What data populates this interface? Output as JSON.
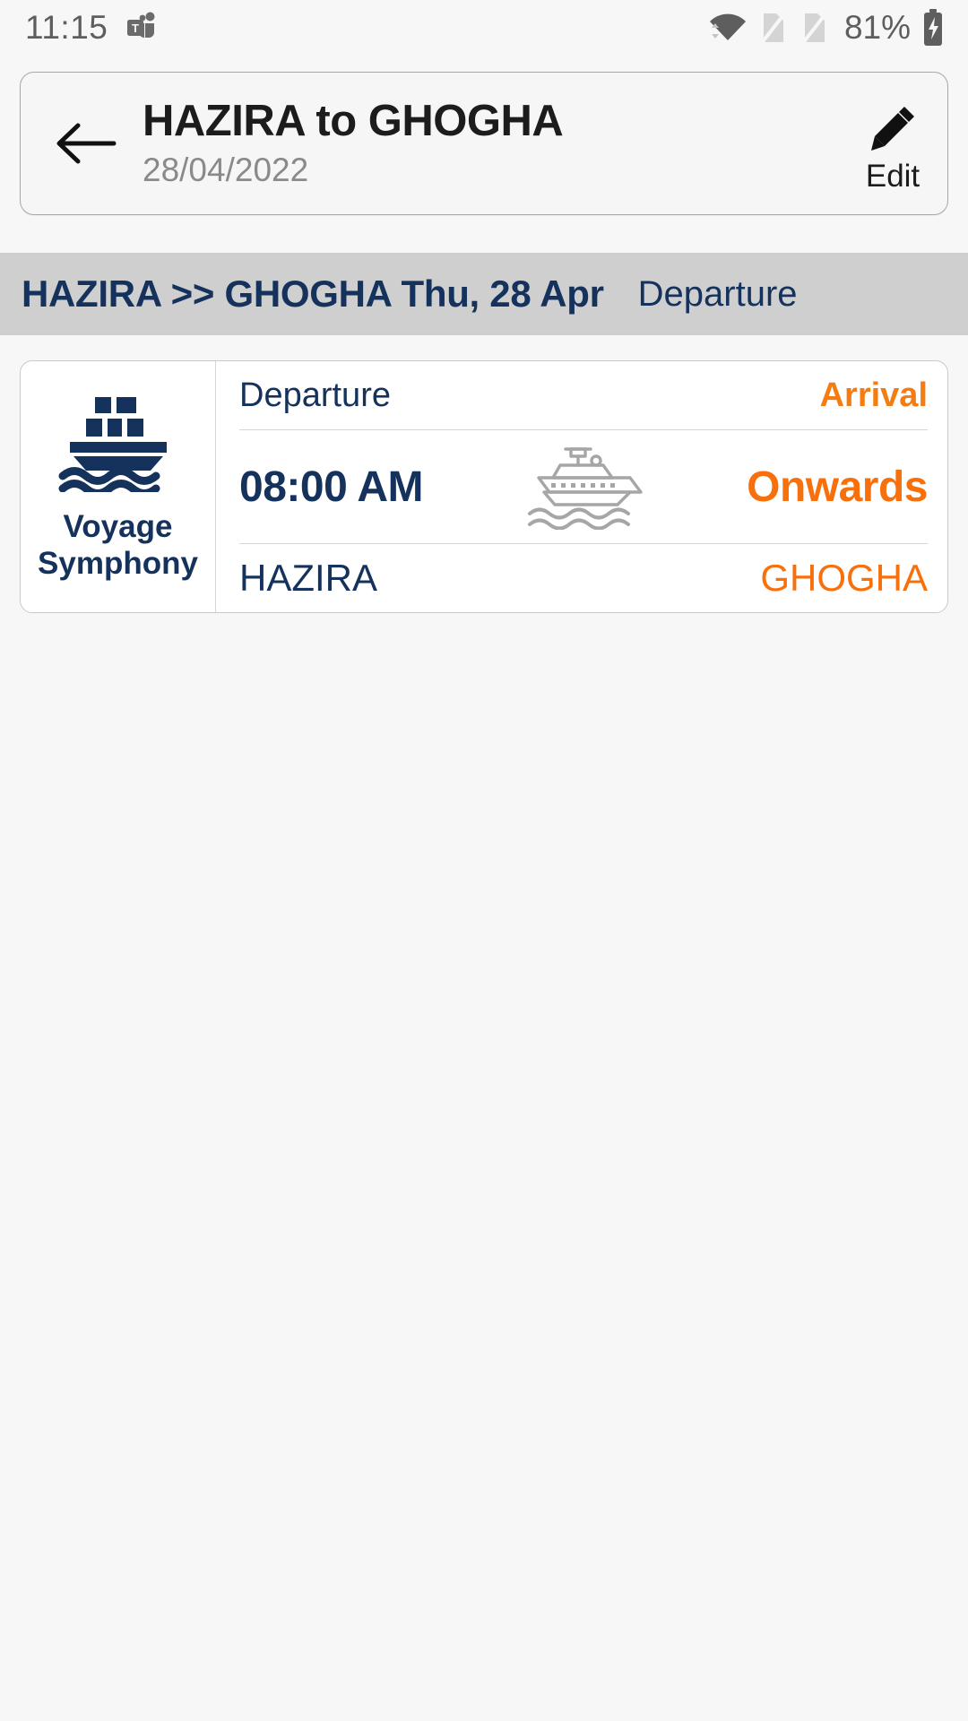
{
  "status_bar": {
    "time": "11:15",
    "battery_percent": "81%",
    "icons": {
      "app": "teams-icon",
      "wifi": "wifi-icon",
      "sim1": "no-sim-icon",
      "sim2": "no-sim-icon",
      "battery": "battery-charging-icon"
    }
  },
  "header": {
    "back_icon": "arrow-left-icon",
    "title": "HAZIRA to GHOGHA",
    "date": "28/04/2022",
    "edit_icon": "pencil-icon",
    "edit_label": "Edit"
  },
  "sub_banner": {
    "route": "HAZIRA >> GHOGHA Thu, 28 Apr",
    "direction": "Departure"
  },
  "voyage_card": {
    "vessel": {
      "logo_icon": "ship-logo-icon",
      "name_line1": "Voyage",
      "name_line2": "Symphony"
    },
    "headers": {
      "departure": "Departure",
      "arrival": "Arrival"
    },
    "times": {
      "departure": "08:00 AM",
      "arrival": "Onwards",
      "transit_icon": "ferry-icon"
    },
    "ports": {
      "departure": "HAZIRA",
      "arrival": "GHOGHA"
    }
  },
  "colors": {
    "navy": "#14325c",
    "orange": "#f7700c",
    "banner_bg": "#cfcfcf",
    "page_bg": "#f7f7f7",
    "card_bg": "#ffffff",
    "muted_text": "#8a8a8a"
  }
}
